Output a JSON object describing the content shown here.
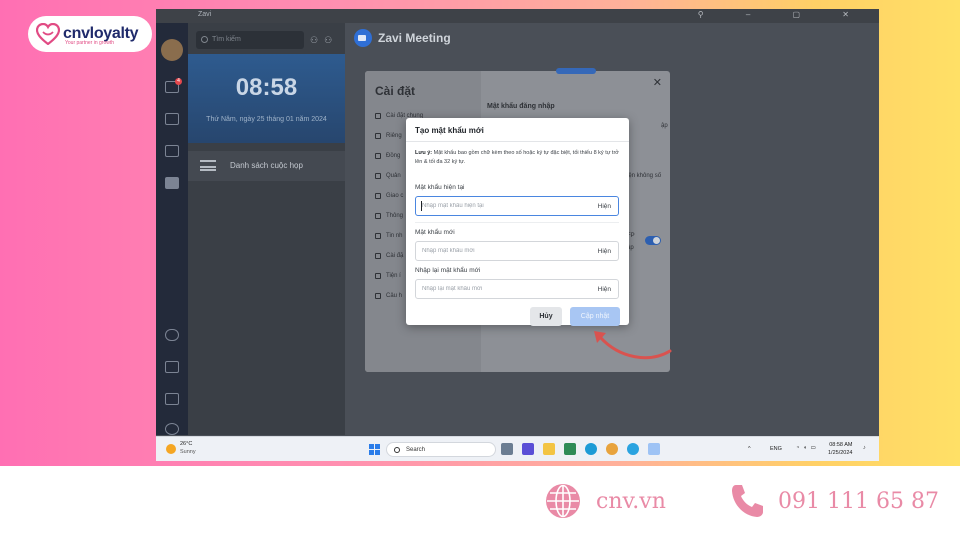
{
  "brand": {
    "name": "cnvloyalty",
    "tagline": "Your partner in growth",
    "website": "cnv.vn",
    "phone": "091 111 65 87",
    "accent": "#e98aa6"
  },
  "window": {
    "title": "Zavi"
  },
  "sidebar": {
    "badge_count": "4"
  },
  "conversations": {
    "search_placeholder": "Tìm kiếm",
    "clock_time": "08:58",
    "clock_date": "Thứ Năm, ngày 25 tháng 01 năm 2024",
    "meeting_list_label": "Danh sách cuộc họp"
  },
  "main": {
    "title": "Zavi Meeting"
  },
  "settings": {
    "title": "Cài đặt",
    "items": [
      "Cài đặt chung",
      "Riêng",
      "Đồng",
      "Quản",
      "Giao c",
      "Thông",
      "Tin nh",
      "Cài đặ",
      "Tiện í",
      "Câu h"
    ],
    "section_title": "Mật khẩu đăng nhập",
    "frag_1": "ập",
    "frag_2": "iện không số",
    "frag_3": "FP",
    "frag_4": "ập"
  },
  "modal": {
    "title": "Tạo mật khẩu mới",
    "note_label": "Lưu ý:",
    "note_text": "Mật khẩu bao gồm chữ kèm theo số hoặc ký tự đặc biệt, tối thiểu 8 ký tự trở lên & tối đa 32 ký tự.",
    "current_label": "Mật khẩu hiện tại",
    "current_placeholder": "Nhập mật khẩu hiện tại",
    "new_label": "Mật khẩu mới",
    "new_placeholder": "Nhập mật khẩu mới",
    "confirm_label": "Nhập lại mật khẩu mới",
    "confirm_placeholder": "Nhập lại mật khẩu mới",
    "show_label": "Hiện",
    "cancel_label": "Hủy",
    "update_label": "Cập nhật"
  },
  "taskbar": {
    "temperature": "26°C",
    "condition": "Sunny",
    "search_label": "Search",
    "language": "ENG",
    "time": "08:58 AM",
    "date": "1/25/2024"
  },
  "colors": {
    "primary_blue": "#2f6fd6",
    "update_disabled": "#a8c6f3",
    "arrow_red": "#d9534f"
  }
}
